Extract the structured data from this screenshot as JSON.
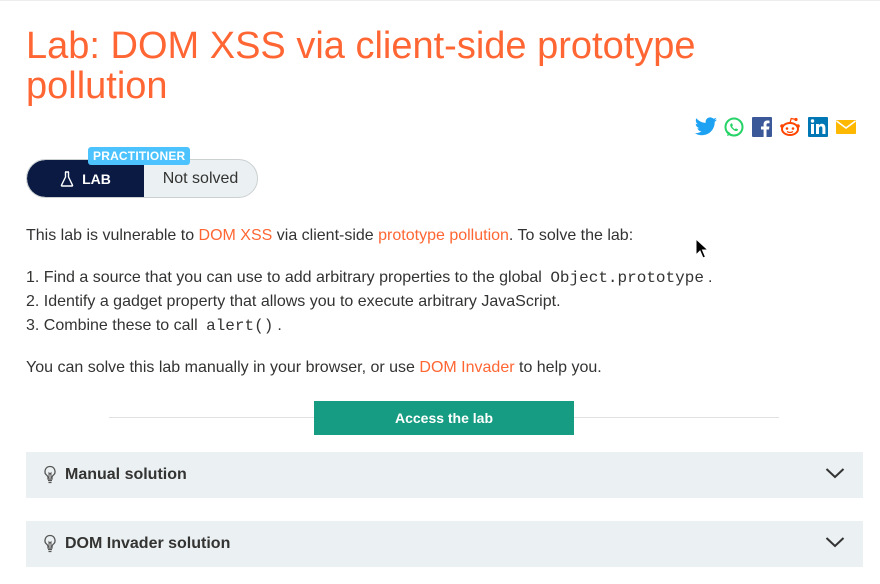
{
  "title": "Lab: DOM XSS via client-side prototype pollution",
  "share_icons": [
    "twitter-icon",
    "whatsapp-icon",
    "facebook-icon",
    "reddit-icon",
    "linkedin-icon",
    "email-icon"
  ],
  "badge": {
    "level": "PRACTITIONER",
    "lab_label": "LAB",
    "status": "Not solved"
  },
  "intro": {
    "before": "This lab is vulnerable to ",
    "link1": "DOM XSS",
    "middle": " via client-side ",
    "link2": "prototype pollution",
    "after": ". To solve the lab:"
  },
  "steps": [
    {
      "text": "1. Find a source that you can use to add arbitrary properties to the global ",
      "code": "Object.prototype",
      "end": "."
    },
    {
      "text": "2. Identify a gadget property that allows you to execute arbitrary JavaScript.",
      "code": "",
      "end": ""
    },
    {
      "text": "3. Combine these to call ",
      "code": "alert()",
      "end": "."
    }
  ],
  "manual": {
    "before": "You can solve this lab manually in your browser, or use ",
    "link": "DOM Invader",
    "after": " to help you."
  },
  "access_button": "Access the lab",
  "accordions": [
    {
      "label": "Manual solution"
    },
    {
      "label": "DOM Invader solution"
    }
  ],
  "colors": {
    "accent": "#ff6633",
    "practitioner": "#4cc3ff",
    "lab_dark": "#0a1a43",
    "access_green": "#159c82",
    "accordion_bg": "#ebf0f2"
  }
}
